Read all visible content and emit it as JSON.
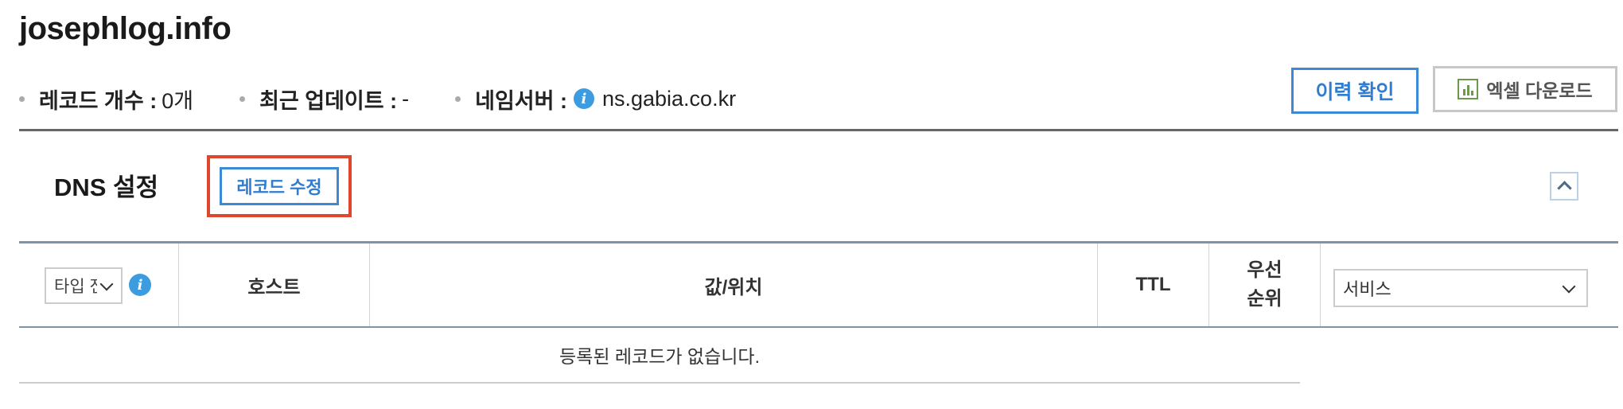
{
  "domain": "josephlog.info",
  "meta": {
    "record_count_label": "레코드 개수 :",
    "record_count_value": "0개",
    "last_update_label": "최근 업데이트 :",
    "last_update_value": "-",
    "nameserver_label": "네임서버 :",
    "nameserver_value": "ns.gabia.co.kr"
  },
  "actions": {
    "history_label": "이력 확인",
    "excel_label": "엑셀 다운로드"
  },
  "section": {
    "title": "DNS 설정",
    "edit_label": "레코드 수정"
  },
  "table": {
    "type_select_value": "타입 전체",
    "headers": {
      "host": "호스트",
      "value": "값/위치",
      "ttl": "TTL",
      "priority_line1": "우선",
      "priority_line2": "순위"
    },
    "service_select_value": "서비스",
    "empty_message": "등록된 레코드가 없습니다."
  },
  "icons": {
    "info": "info-icon",
    "excel": "excel-chart-icon",
    "collapse": "chevron-up-icon",
    "dropdown": "chevron-down-icon"
  },
  "colors": {
    "accent_blue": "#2e7dd1",
    "highlight_red": "#e0452e",
    "info_blue": "#3d9be0",
    "excel_green": "#6a9a4b"
  }
}
